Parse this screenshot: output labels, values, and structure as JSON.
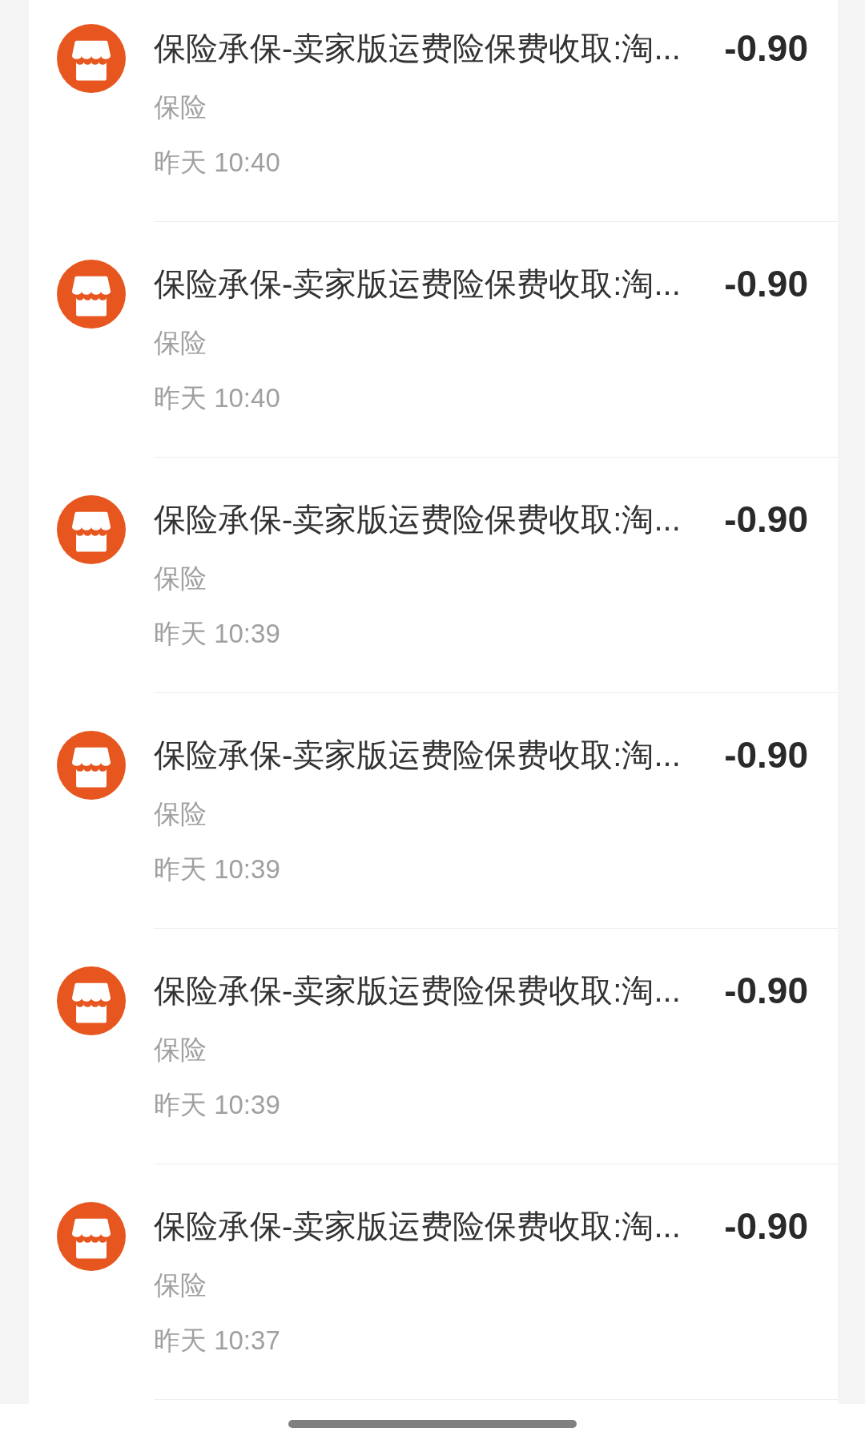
{
  "transactions": [
    {
      "title": "保险承保-卖家版运费险保费收取:淘...",
      "category": "保险",
      "time": "昨天 10:40",
      "amount": "-0.90"
    },
    {
      "title": "保险承保-卖家版运费险保费收取:淘...",
      "category": "保险",
      "time": "昨天 10:40",
      "amount": "-0.90"
    },
    {
      "title": "保险承保-卖家版运费险保费收取:淘...",
      "category": "保险",
      "time": "昨天 10:39",
      "amount": "-0.90"
    },
    {
      "title": "保险承保-卖家版运费险保费收取:淘...",
      "category": "保险",
      "time": "昨天 10:39",
      "amount": "-0.90"
    },
    {
      "title": "保险承保-卖家版运费险保费收取:淘...",
      "category": "保险",
      "time": "昨天 10:39",
      "amount": "-0.90"
    },
    {
      "title": "保险承保-卖家版运费险保费收取:淘...",
      "category": "保险",
      "time": "昨天 10:37",
      "amount": "-0.90"
    }
  ]
}
